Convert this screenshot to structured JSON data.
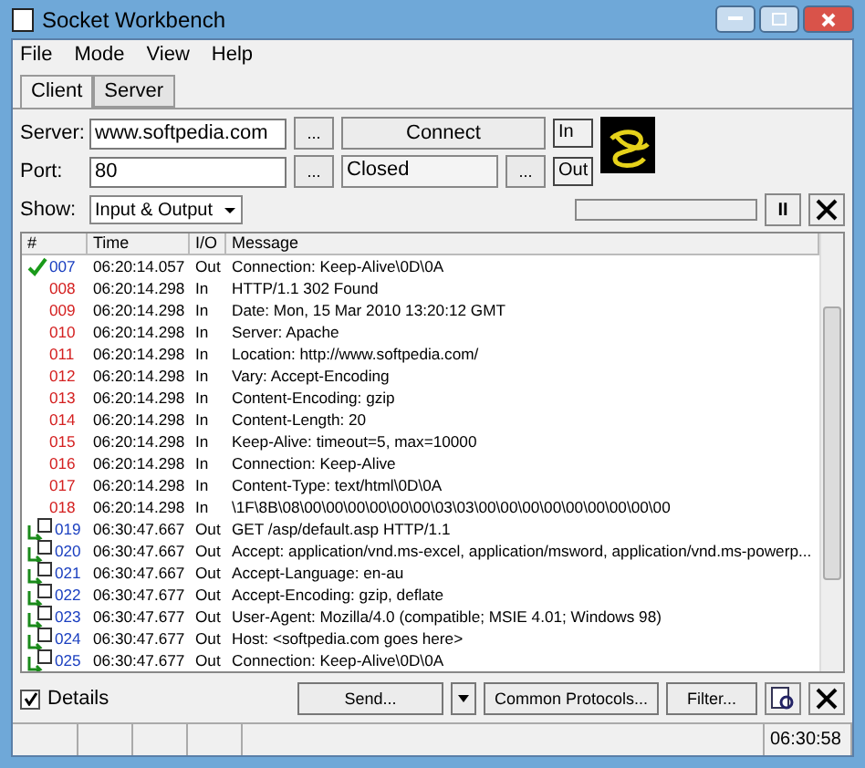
{
  "window": {
    "title": "Socket Workbench"
  },
  "menu": [
    "File",
    "Mode",
    "View",
    "Help"
  ],
  "tabs": [
    {
      "label": "Client",
      "selected": true
    },
    {
      "label": "Server",
      "selected": false
    }
  ],
  "server": {
    "label": "Server:",
    "value": "www.softpedia.com",
    "browse": "..."
  },
  "port": {
    "label": "Port:",
    "value": "80",
    "browse": "..."
  },
  "connect_button": "Connect",
  "status": {
    "value": "Closed",
    "browse": "..."
  },
  "indicators": [
    "In",
    "Out"
  ],
  "show": {
    "label": "Show:",
    "value": "Input & Output"
  },
  "progress": {
    "level": 0
  },
  "pause_button": "II",
  "columns": [
    "#",
    "Time",
    "I/O",
    "Message"
  ],
  "rows": [
    {
      "kind": "ok",
      "num": "007",
      "time": "06:20:14.057",
      "io": "Out",
      "message": "Connection: Keep-Alive\\0D\\0A"
    },
    {
      "kind": "in",
      "num": "008",
      "time": "06:20:14.298",
      "io": "In",
      "message": "HTTP/1.1 302 Found"
    },
    {
      "kind": "in",
      "num": "009",
      "time": "06:20:14.298",
      "io": "In",
      "message": "Date: Mon, 15 Mar 2010 13:20:12 GMT"
    },
    {
      "kind": "in",
      "num": "010",
      "time": "06:20:14.298",
      "io": "In",
      "message": "Server: Apache"
    },
    {
      "kind": "in",
      "num": "011",
      "time": "06:20:14.298",
      "io": "In",
      "message": "Location: http://www.softpedia.com/"
    },
    {
      "kind": "in",
      "num": "012",
      "time": "06:20:14.298",
      "io": "In",
      "message": "Vary: Accept-Encoding"
    },
    {
      "kind": "in",
      "num": "013",
      "time": "06:20:14.298",
      "io": "In",
      "message": "Content-Encoding: gzip"
    },
    {
      "kind": "in",
      "num": "014",
      "time": "06:20:14.298",
      "io": "In",
      "message": "Content-Length: 20"
    },
    {
      "kind": "in",
      "num": "015",
      "time": "06:20:14.298",
      "io": "In",
      "message": "Keep-Alive: timeout=5, max=10000"
    },
    {
      "kind": "in",
      "num": "016",
      "time": "06:20:14.298",
      "io": "In",
      "message": "Connection: Keep-Alive"
    },
    {
      "kind": "in",
      "num": "017",
      "time": "06:20:14.298",
      "io": "In",
      "message": "Content-Type: text/html\\0D\\0A"
    },
    {
      "kind": "in",
      "num": "018",
      "time": "06:20:14.298",
      "io": "In",
      "message": "\\1F\\8B\\08\\00\\00\\00\\00\\00\\00\\03\\03\\00\\00\\00\\00\\00\\00\\00\\00\\00"
    },
    {
      "kind": "out",
      "num": "019",
      "time": "06:30:47.667",
      "io": "Out",
      "message": "GET /asp/default.asp HTTP/1.1"
    },
    {
      "kind": "out",
      "num": "020",
      "time": "06:30:47.667",
      "io": "Out",
      "message": "Accept: application/vnd.ms-excel, application/msword, application/vnd.ms-powerp..."
    },
    {
      "kind": "out",
      "num": "021",
      "time": "06:30:47.667",
      "io": "Out",
      "message": "Accept-Language: en-au"
    },
    {
      "kind": "out",
      "num": "022",
      "time": "06:30:47.677",
      "io": "Out",
      "message": "Accept-Encoding: gzip, deflate"
    },
    {
      "kind": "out",
      "num": "023",
      "time": "06:30:47.677",
      "io": "Out",
      "message": "User-Agent: Mozilla/4.0 (compatible; MSIE 4.01; Windows 98)"
    },
    {
      "kind": "out",
      "num": "024",
      "time": "06:30:47.677",
      "io": "Out",
      "message": "Host: <softpedia.com goes here>"
    },
    {
      "kind": "out",
      "num": "025",
      "time": "06:30:47.677",
      "io": "Out",
      "message": "Connection: Keep-Alive\\0D\\0A"
    }
  ],
  "details": {
    "label": "Details",
    "checked": true
  },
  "send_button": "Send...",
  "protocols_button": "Common Protocols...",
  "filter_button": "Filter...",
  "status_bar": {
    "time": "06:30:58"
  }
}
